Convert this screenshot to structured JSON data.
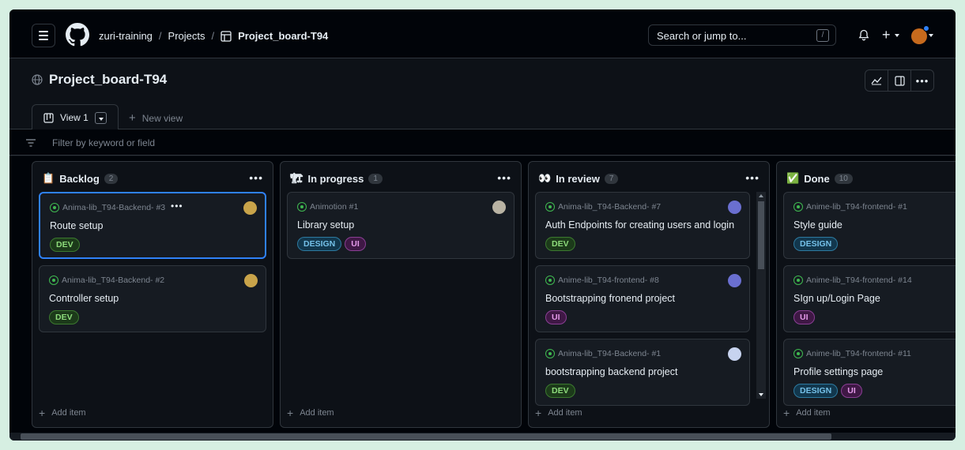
{
  "nav": {
    "org": "zuri-training",
    "projects": "Projects",
    "project": "Project_board-T94",
    "search_placeholder": "Search or jump to...",
    "search_shortcut": "/"
  },
  "page": {
    "title": "Project_board-T94"
  },
  "tabs": {
    "view_label": "View 1",
    "new_view": "New view"
  },
  "filter": {
    "placeholder": "Filter by keyword or field"
  },
  "add_item": "Add item",
  "columns": [
    {
      "name": "Backlog",
      "emoji": "📋",
      "count": "2",
      "cards": [
        {
          "ref": "Anima-lib_T94-Backend- #3",
          "title": "Route setup",
          "labels": [
            "DEV"
          ]
        },
        {
          "ref": "Anima-lib_T94-Backend- #2",
          "title": "Controller setup",
          "labels": [
            "DEV"
          ]
        }
      ]
    },
    {
      "name": "In progress",
      "emoji": "🏗",
      "count": "1",
      "cards": [
        {
          "ref": "Animotion #1",
          "title": "Library setup",
          "labels": [
            "DESIGN",
            "UI"
          ]
        }
      ]
    },
    {
      "name": "In review",
      "emoji": "👀",
      "count": "7",
      "cards": [
        {
          "ref": "Anima-lib_T94-Backend- #7",
          "title": "Auth Endpoints for creating users and login",
          "labels": [
            "DEV"
          ]
        },
        {
          "ref": "Anime-lib_T94-frontend- #8",
          "title": "Bootstrapping fronend project",
          "labels": [
            "UI"
          ]
        },
        {
          "ref": "Anima-lib_T94-Backend- #1",
          "title": "bootstrapping backend project",
          "labels": [
            "DEV"
          ]
        }
      ]
    },
    {
      "name": "Done",
      "emoji": "✅",
      "count": "10",
      "cards": [
        {
          "ref": "Anime-lib_T94-frontend- #1",
          "title": "Style guide",
          "labels": [
            "DESIGN"
          ]
        },
        {
          "ref": "Anime-lib_T94-frontend- #14",
          "title": "SIgn up/Login Page",
          "labels": [
            "UI"
          ]
        },
        {
          "ref": "Anime-lib_T94-frontend- #11",
          "title": "Profile settings page",
          "labels": [
            "DESIGN",
            "UI"
          ]
        }
      ]
    }
  ],
  "colors": {
    "background": "#0d1117",
    "accent": "#2f81f7",
    "open_issue": "#3fb950"
  }
}
